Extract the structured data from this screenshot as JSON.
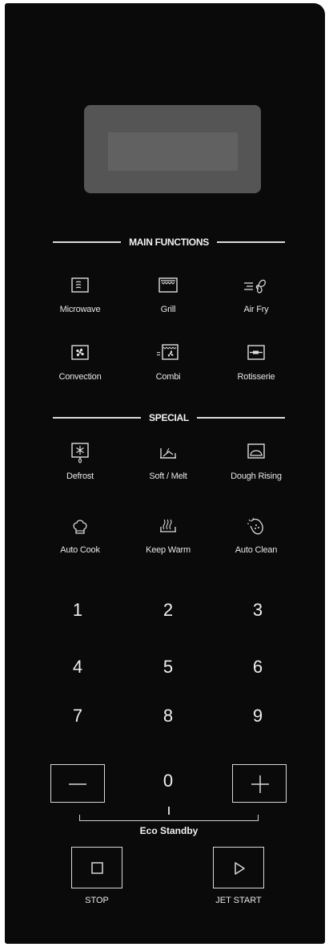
{
  "display": {},
  "sections": {
    "main": "MAIN FUNCTIONS",
    "special": "SPECIAL"
  },
  "main_functions": [
    {
      "label": "Microwave",
      "icon": "microwave-icon"
    },
    {
      "label": "Grill",
      "icon": "grill-icon"
    },
    {
      "label": "Air Fry",
      "icon": "air-fry-icon"
    },
    {
      "label": "Convection",
      "icon": "convection-icon"
    },
    {
      "label": "Combi",
      "icon": "combi-icon"
    },
    {
      "label": "Rotisserie",
      "icon": "rotisserie-icon"
    }
  ],
  "special_functions": [
    {
      "label": "Defrost",
      "icon": "defrost-icon"
    },
    {
      "label": "Soft / Melt",
      "icon": "soft-melt-icon"
    },
    {
      "label": "Dough Rising",
      "icon": "dough-rising-icon"
    },
    {
      "label": "Auto Cook",
      "icon": "chef-hat-icon"
    },
    {
      "label": "Keep Warm",
      "icon": "keep-warm-icon"
    },
    {
      "label": "Auto Clean",
      "icon": "auto-clean-icon"
    }
  ],
  "keypad": {
    "digits": [
      "1",
      "2",
      "3",
      "4",
      "5",
      "6",
      "7",
      "8",
      "9"
    ],
    "zero": "0",
    "minus_icon": "minus-icon",
    "plus_icon": "plus-icon"
  },
  "eco_standby": "Eco Standby",
  "stop_label": "STOP",
  "start_label": "JET START",
  "colors": {
    "panel": "#0a0a0a",
    "display": "#555555",
    "text": "#e8e8e8"
  }
}
